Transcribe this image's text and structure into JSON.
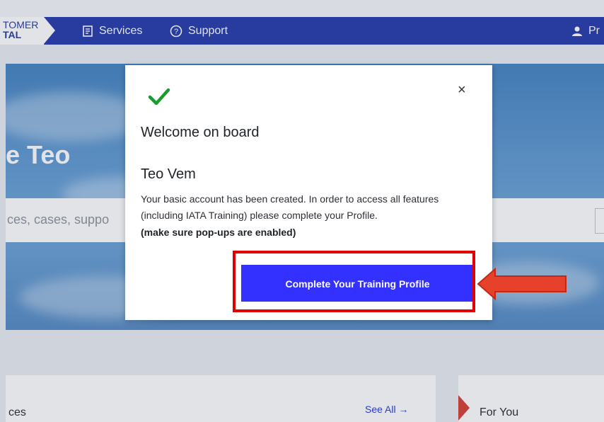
{
  "nav": {
    "logo_line1": "TOMER",
    "logo_line2": "TAL",
    "services_label": "Services",
    "support_label": "Support",
    "profile_label": "Pr"
  },
  "hero": {
    "title": "e Teo",
    "search_placeholder": "ces, cases, suppo"
  },
  "modal": {
    "title": "Welcome on board",
    "name": "Teo Vem",
    "message": "Your basic account has been created. In order to access all features (including IATA Training) please complete your Profile.",
    "note": "(make sure pop-ups are enabled)",
    "cta_label": "Complete Your Training Profile",
    "close_glyph": "×"
  },
  "lower": {
    "left_title": "ces",
    "see_all_label": "See All →",
    "right_title": "For You"
  },
  "colors": {
    "nav_bg": "#1e32a6",
    "cta_bg": "#3331ff",
    "check_green": "#1a9b2f",
    "annotation_red": "#e00000"
  },
  "icons": [
    "services-icon",
    "support-icon",
    "profile-icon",
    "check-icon",
    "close-icon",
    "arrow-right-icon"
  ]
}
